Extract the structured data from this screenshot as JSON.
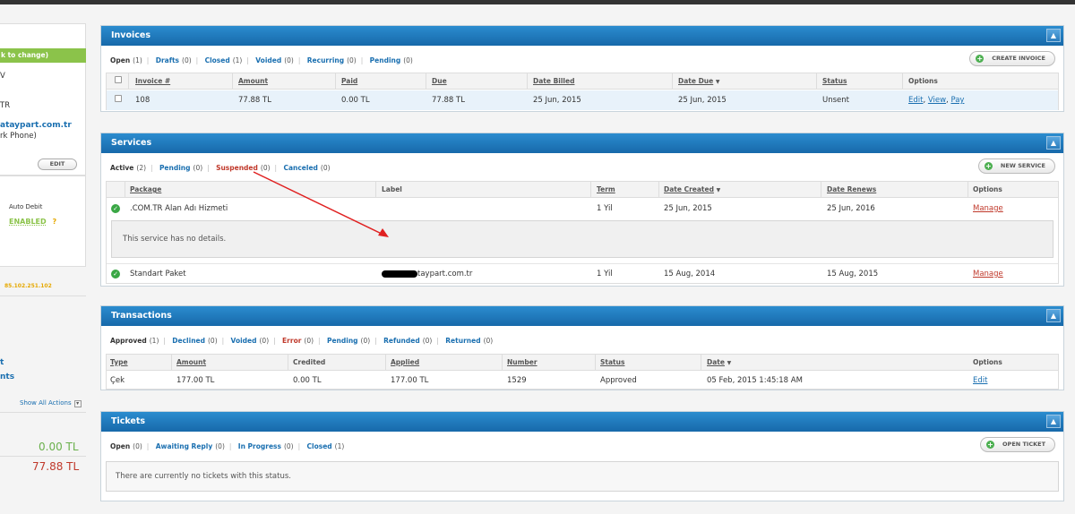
{
  "sidebar": {
    "green_bar": "k to change)",
    "line1": "V",
    "line2": "TR",
    "email": "ataypart.com.tr",
    "phone": "rk Phone)",
    "edit_button": "EDIT",
    "auto_debit_label": "Auto Debit",
    "auto_debit_status": "ENABLED",
    "help_mark": "?",
    "ip": "85.102.251.102",
    "link1": "t",
    "link2": "nts",
    "show_all_actions": "Show All Actions",
    "credit_amount": "0.00 TL",
    "due_amount": "77.88 TL"
  },
  "invoices": {
    "title": "Invoices",
    "toggle": "▲",
    "filters": [
      {
        "label": "Open",
        "count": "(1)"
      },
      {
        "label": "Drafts",
        "count": "(0)"
      },
      {
        "label": "Closed",
        "count": "(1)"
      },
      {
        "label": "Voided",
        "count": "(0)"
      },
      {
        "label": "Recurring",
        "count": "(0)"
      },
      {
        "label": "Pending",
        "count": "(0)"
      }
    ],
    "create_button": "CREATE INVOICE",
    "headers": [
      "Invoice #",
      "Amount",
      "Paid",
      "Due",
      "Date Billed",
      "Date Due",
      "Status",
      "Options"
    ],
    "date_due_sort": "▼",
    "row": {
      "invoice": "108",
      "amount": "77.88 TL",
      "paid": "0.00 TL",
      "due": "77.88 TL",
      "date_billed": "25 Jun, 2015",
      "date_due": "25 Jun, 2015",
      "status": "Unsent",
      "opt_edit": "Edit",
      "opt_view": "View",
      "opt_pay": "Pay"
    }
  },
  "services": {
    "title": "Services",
    "toggle": "▲",
    "filters": [
      {
        "label": "Active",
        "count": "(2)"
      },
      {
        "label": "Pending",
        "count": "(0)"
      },
      {
        "label": "Suspended",
        "count": "(0)"
      },
      {
        "label": "Canceled",
        "count": "(0)"
      }
    ],
    "new_button": "NEW SERVICE",
    "headers": [
      "Package",
      "Label",
      "Term",
      "Date Created",
      "Date Renews",
      "Options"
    ],
    "date_created_sort": "▼",
    "rows": [
      {
        "package": ".COM.TR Alan Adı Hizmeti",
        "label": "",
        "term": "1 Yil",
        "created": "25 Jun, 2015",
        "renews": "25 Jun, 2016",
        "option": "Manage"
      },
      {
        "package": "Standart Paket",
        "label": "taypart.com.tr",
        "term": "1 Yil",
        "created": "15 Aug, 2014",
        "renews": "15 Aug, 2015",
        "option": "Manage"
      }
    ],
    "no_details": "This service has no details.",
    "arrow_color": "#e02020"
  },
  "transactions": {
    "title": "Transactions",
    "toggle": "▲",
    "filters": [
      {
        "label": "Approved",
        "count": "(1)"
      },
      {
        "label": "Declined",
        "count": "(0)"
      },
      {
        "label": "Voided",
        "count": "(0)"
      },
      {
        "label": "Error",
        "count": "(0)"
      },
      {
        "label": "Pending",
        "count": "(0)"
      },
      {
        "label": "Refunded",
        "count": "(0)"
      },
      {
        "label": "Returned",
        "count": "(0)"
      }
    ],
    "headers": [
      "Type",
      "Amount",
      "Credited",
      "Applied",
      "Number",
      "Status",
      "Date",
      "Options"
    ],
    "date_sort": "▼",
    "row": {
      "type": "Çek",
      "amount": "177.00 TL",
      "credited": "0.00 TL",
      "applied": "177.00 TL",
      "number": "1529",
      "status": "Approved",
      "date": "05 Feb, 2015 1:45:18 AM",
      "option": "Edit"
    }
  },
  "tickets": {
    "title": "Tickets",
    "toggle": "▲",
    "filters": [
      {
        "label": "Open",
        "count": "(0)"
      },
      {
        "label": "Awaiting Reply",
        "count": "(0)"
      },
      {
        "label": "In Progress",
        "count": "(0)"
      },
      {
        "label": "Closed",
        "count": "(1)"
      }
    ],
    "open_button": "OPEN TICKET",
    "empty_text": "There are currently no tickets with this status."
  },
  "icons": {
    "plus": "+",
    "check": "✓",
    "chevron": "▾"
  }
}
